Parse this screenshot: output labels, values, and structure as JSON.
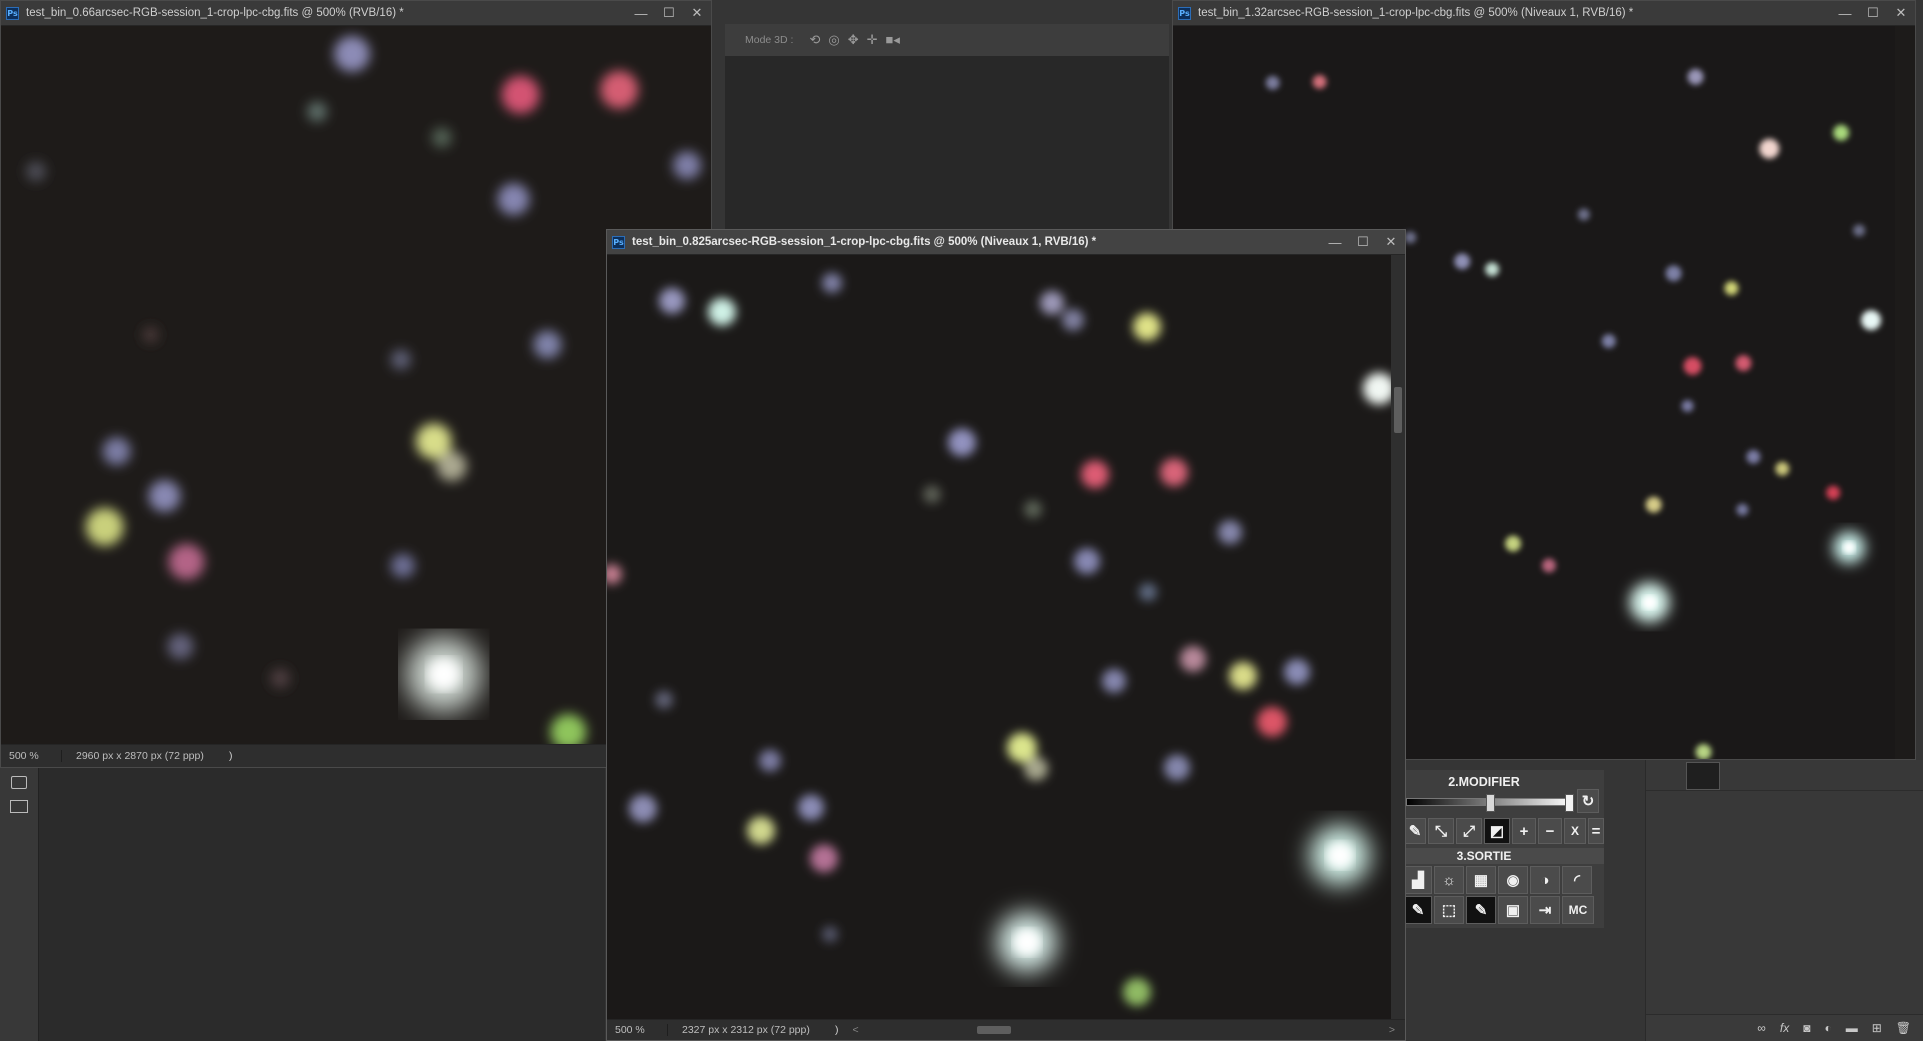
{
  "windows": {
    "left": {
      "title": "test_bin_0.66arcsec-RGB-session_1-crop-lpc-cbg.fits @ 500% (RVB/16) *",
      "zoom": "500 %",
      "dims": "2960 px x 2870 px (72 ppp)",
      "arrow": ")"
    },
    "right": {
      "title": "test_bin_1.32arcsec-RGB-session_1-crop-lpc-cbg.fits @ 500% (Niveaux 1, RVB/16) *"
    },
    "center": {
      "title": "test_bin_0.825arcsec-RGB-session_1-crop-lpc-cbg.fits @ 500% (Niveaux 1, RVB/16) *",
      "zoom": "500 %",
      "dims": "2327 px x 2312 px (72 ppp)",
      "arrow": ")",
      "hscroll_left": "<",
      "hscroll_right": ">"
    }
  },
  "window_buttons": {
    "minimize": "—",
    "maximize": "☐",
    "close": "✕"
  },
  "mode3d": {
    "label": "Mode 3D :"
  },
  "plugin_panel": {
    "modify_title": "2.MODIFIER",
    "output_title": "3.SORTIE",
    "op_buttons": [
      "+",
      "−",
      "X",
      "="
    ],
    "mc_button": "MC"
  },
  "colors": {
    "chrome": "#353535",
    "titlebar": "#3a3a3a",
    "active_titlebar": "#434343",
    "sky": "#1d1b1a"
  },
  "icons": [
    "ps-icon",
    "rotate-3d-icon",
    "roll-3d-icon",
    "pan-3d-icon",
    "slide-3d-icon",
    "camera-3d-icon",
    "reset-icon",
    "brush-icon",
    "expand-icon",
    "contract-icon",
    "mask-icon",
    "histogram-icon",
    "brightness-icon",
    "film-icon",
    "camera-icon",
    "halfmoon-icon",
    "paint-icon",
    "selection-icon",
    "image-icon",
    "export-icon",
    "link-icon",
    "fx-icon",
    "layer-mask-icon",
    "adjustment-icon",
    "folder-icon",
    "new-layer-icon",
    "trash-icon"
  ]
}
